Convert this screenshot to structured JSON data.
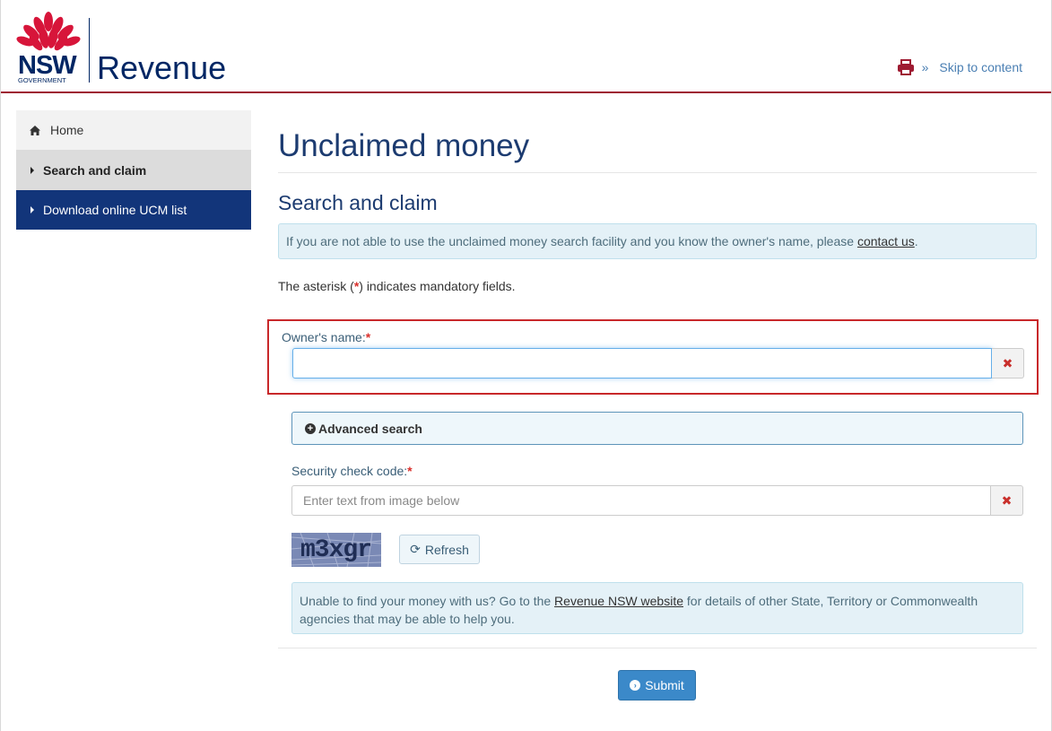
{
  "header": {
    "logo_nsw": "NSW",
    "logo_government": "GOVERNMENT",
    "logo_revenue": "Revenue",
    "skip_link": "Skip to content",
    "brand_color": "#002664",
    "accent_color": "#9e1b32"
  },
  "sidebar": {
    "items": [
      {
        "label": "Home",
        "icon": "home-icon"
      },
      {
        "label": "Search and claim",
        "icon": "caret-right-icon",
        "active": true
      },
      {
        "label": "Download online UCM list",
        "icon": "caret-right-icon"
      }
    ]
  },
  "main": {
    "title": "Unclaimed money",
    "subtitle": "Search and claim",
    "alert_text": "If you are not able to use the unclaimed money search facility and you know the owner's name, please ",
    "alert_link": "contact us",
    "alert_end": ".",
    "mandatory_prefix": "The asterisk (",
    "mandatory_star": "*",
    "mandatory_suffix": ") indicates mandatory fields.",
    "owner_label": "Owner's name:",
    "owner_value": "",
    "advanced_search": "Advanced search",
    "security_label": "Security check code:",
    "security_placeholder": "Enter text from image below",
    "captcha_text": "m3xgr",
    "refresh_label": "Refresh",
    "info_text_1": "Unable to find your money with us? Go to the ",
    "info_link": "Revenue NSW website",
    "info_text_2": " for details of other State, Territory or Commonwealth agencies that may be able to help you.",
    "submit_label": "Submit",
    "clear_symbol": "✖",
    "required_star": "*"
  }
}
